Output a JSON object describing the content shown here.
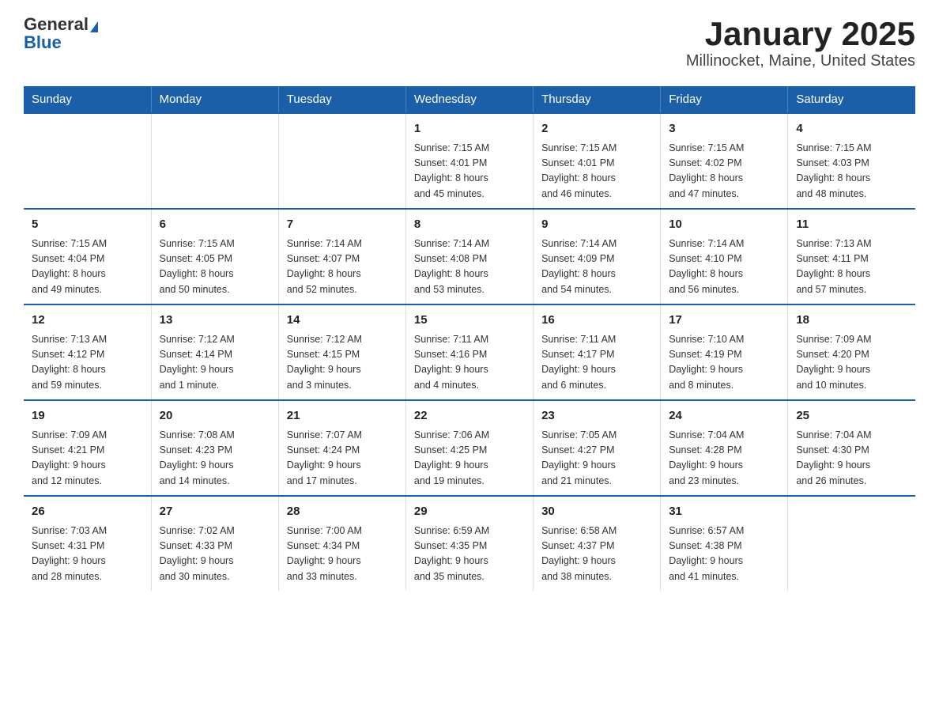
{
  "header": {
    "logo_general": "General",
    "logo_blue": "Blue",
    "title": "January 2025",
    "location": "Millinocket, Maine, United States"
  },
  "days_of_week": [
    "Sunday",
    "Monday",
    "Tuesday",
    "Wednesday",
    "Thursday",
    "Friday",
    "Saturday"
  ],
  "weeks": [
    [
      {
        "day": "",
        "info": ""
      },
      {
        "day": "",
        "info": ""
      },
      {
        "day": "",
        "info": ""
      },
      {
        "day": "1",
        "info": "Sunrise: 7:15 AM\nSunset: 4:01 PM\nDaylight: 8 hours\nand 45 minutes."
      },
      {
        "day": "2",
        "info": "Sunrise: 7:15 AM\nSunset: 4:01 PM\nDaylight: 8 hours\nand 46 minutes."
      },
      {
        "day": "3",
        "info": "Sunrise: 7:15 AM\nSunset: 4:02 PM\nDaylight: 8 hours\nand 47 minutes."
      },
      {
        "day": "4",
        "info": "Sunrise: 7:15 AM\nSunset: 4:03 PM\nDaylight: 8 hours\nand 48 minutes."
      }
    ],
    [
      {
        "day": "5",
        "info": "Sunrise: 7:15 AM\nSunset: 4:04 PM\nDaylight: 8 hours\nand 49 minutes."
      },
      {
        "day": "6",
        "info": "Sunrise: 7:15 AM\nSunset: 4:05 PM\nDaylight: 8 hours\nand 50 minutes."
      },
      {
        "day": "7",
        "info": "Sunrise: 7:14 AM\nSunset: 4:07 PM\nDaylight: 8 hours\nand 52 minutes."
      },
      {
        "day": "8",
        "info": "Sunrise: 7:14 AM\nSunset: 4:08 PM\nDaylight: 8 hours\nand 53 minutes."
      },
      {
        "day": "9",
        "info": "Sunrise: 7:14 AM\nSunset: 4:09 PM\nDaylight: 8 hours\nand 54 minutes."
      },
      {
        "day": "10",
        "info": "Sunrise: 7:14 AM\nSunset: 4:10 PM\nDaylight: 8 hours\nand 56 minutes."
      },
      {
        "day": "11",
        "info": "Sunrise: 7:13 AM\nSunset: 4:11 PM\nDaylight: 8 hours\nand 57 minutes."
      }
    ],
    [
      {
        "day": "12",
        "info": "Sunrise: 7:13 AM\nSunset: 4:12 PM\nDaylight: 8 hours\nand 59 minutes."
      },
      {
        "day": "13",
        "info": "Sunrise: 7:12 AM\nSunset: 4:14 PM\nDaylight: 9 hours\nand 1 minute."
      },
      {
        "day": "14",
        "info": "Sunrise: 7:12 AM\nSunset: 4:15 PM\nDaylight: 9 hours\nand 3 minutes."
      },
      {
        "day": "15",
        "info": "Sunrise: 7:11 AM\nSunset: 4:16 PM\nDaylight: 9 hours\nand 4 minutes."
      },
      {
        "day": "16",
        "info": "Sunrise: 7:11 AM\nSunset: 4:17 PM\nDaylight: 9 hours\nand 6 minutes."
      },
      {
        "day": "17",
        "info": "Sunrise: 7:10 AM\nSunset: 4:19 PM\nDaylight: 9 hours\nand 8 minutes."
      },
      {
        "day": "18",
        "info": "Sunrise: 7:09 AM\nSunset: 4:20 PM\nDaylight: 9 hours\nand 10 minutes."
      }
    ],
    [
      {
        "day": "19",
        "info": "Sunrise: 7:09 AM\nSunset: 4:21 PM\nDaylight: 9 hours\nand 12 minutes."
      },
      {
        "day": "20",
        "info": "Sunrise: 7:08 AM\nSunset: 4:23 PM\nDaylight: 9 hours\nand 14 minutes."
      },
      {
        "day": "21",
        "info": "Sunrise: 7:07 AM\nSunset: 4:24 PM\nDaylight: 9 hours\nand 17 minutes."
      },
      {
        "day": "22",
        "info": "Sunrise: 7:06 AM\nSunset: 4:25 PM\nDaylight: 9 hours\nand 19 minutes."
      },
      {
        "day": "23",
        "info": "Sunrise: 7:05 AM\nSunset: 4:27 PM\nDaylight: 9 hours\nand 21 minutes."
      },
      {
        "day": "24",
        "info": "Sunrise: 7:04 AM\nSunset: 4:28 PM\nDaylight: 9 hours\nand 23 minutes."
      },
      {
        "day": "25",
        "info": "Sunrise: 7:04 AM\nSunset: 4:30 PM\nDaylight: 9 hours\nand 26 minutes."
      }
    ],
    [
      {
        "day": "26",
        "info": "Sunrise: 7:03 AM\nSunset: 4:31 PM\nDaylight: 9 hours\nand 28 minutes."
      },
      {
        "day": "27",
        "info": "Sunrise: 7:02 AM\nSunset: 4:33 PM\nDaylight: 9 hours\nand 30 minutes."
      },
      {
        "day": "28",
        "info": "Sunrise: 7:00 AM\nSunset: 4:34 PM\nDaylight: 9 hours\nand 33 minutes."
      },
      {
        "day": "29",
        "info": "Sunrise: 6:59 AM\nSunset: 4:35 PM\nDaylight: 9 hours\nand 35 minutes."
      },
      {
        "day": "30",
        "info": "Sunrise: 6:58 AM\nSunset: 4:37 PM\nDaylight: 9 hours\nand 38 minutes."
      },
      {
        "day": "31",
        "info": "Sunrise: 6:57 AM\nSunset: 4:38 PM\nDaylight: 9 hours\nand 41 minutes."
      },
      {
        "day": "",
        "info": ""
      }
    ]
  ]
}
